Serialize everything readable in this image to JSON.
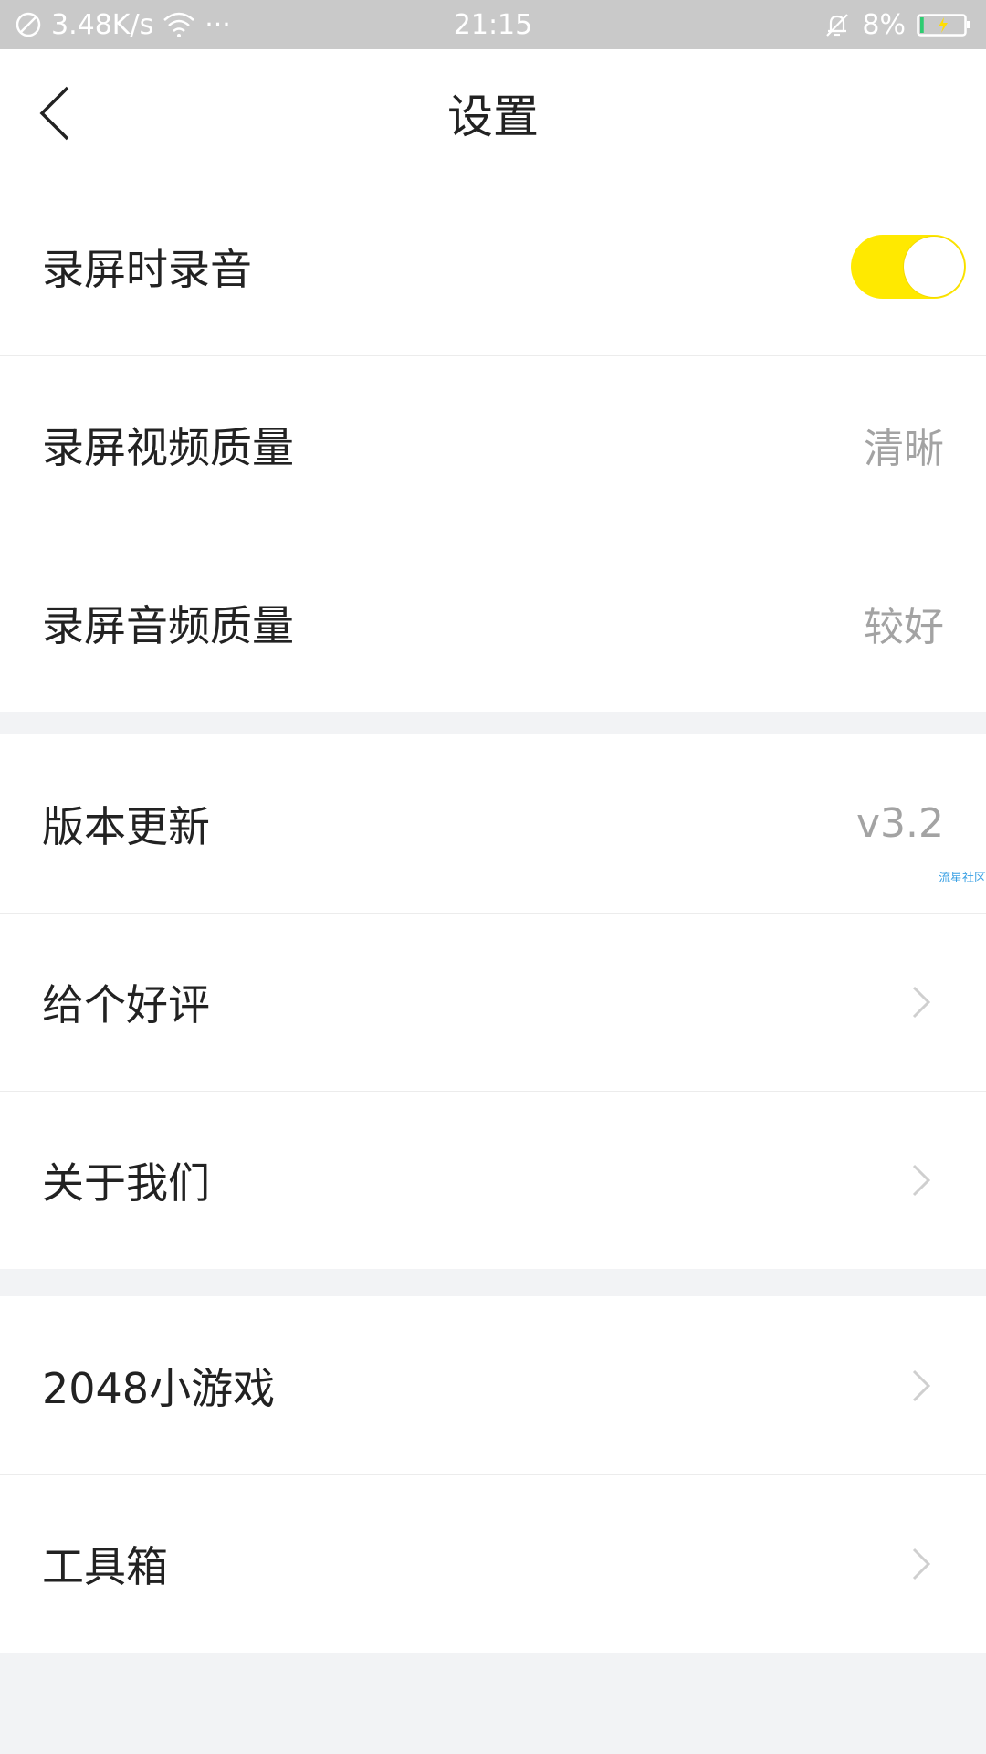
{
  "status_bar": {
    "net_speed": "3.48K/s",
    "more": "···",
    "time": "21:15",
    "battery": "8%",
    "icons": [
      "no-sim-icon",
      "wifi-icon",
      "more-dots-icon",
      "bell-muted-icon",
      "battery-charging-icon"
    ],
    "battery_level": 0.08
  },
  "header": {
    "title": "设置",
    "back_icon": "chevron-left-icon"
  },
  "group1": {
    "items": [
      {
        "label": "录屏时录音",
        "toggle_on": true
      },
      {
        "label": "录屏视频质量",
        "value": "清晰"
      },
      {
        "label": "录屏音频质量",
        "value": "较好"
      }
    ]
  },
  "group2": {
    "items": [
      {
        "label": "版本更新",
        "value": "v3.2"
      },
      {
        "label": "给个好评"
      },
      {
        "label": "关于我们"
      }
    ]
  },
  "group3": {
    "items": [
      {
        "label": "2048小游戏"
      },
      {
        "label": "工具箱"
      }
    ]
  },
  "watermark": "流星社区",
  "colors": {
    "accent": "#ffe900",
    "status_bar": "#c9c9c9",
    "text_primary": "#222222",
    "text_secondary": "#a3a3a3",
    "background": "#f2f3f5"
  }
}
